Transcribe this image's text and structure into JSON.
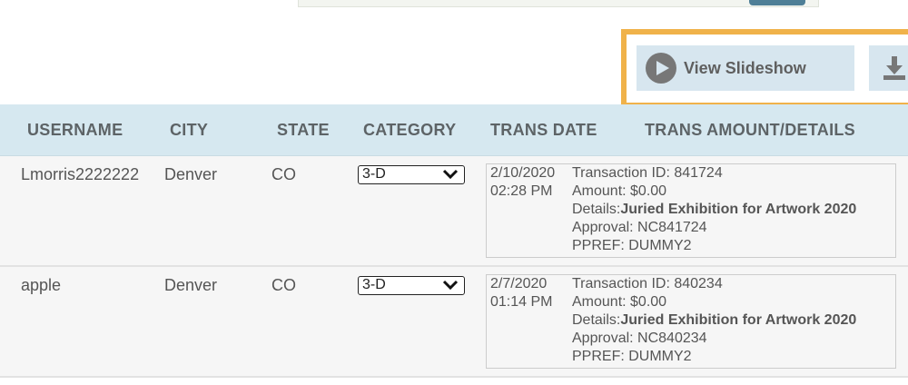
{
  "actions": {
    "slideshow_label": "View Slideshow"
  },
  "table": {
    "headers": [
      "USERNAME",
      "CITY",
      "STATE",
      "CATEGORY",
      "TRANS DATE",
      "TRANS AMOUNT/DETAILS"
    ],
    "rows": [
      {
        "username": "Lmorris2222222",
        "city": "Denver",
        "state": "CO",
        "category": "3-D",
        "date": "2/10/2020",
        "time": "02:28 PM",
        "transaction_id": "Transaction ID: 841724",
        "amount": "Amount: $0.00",
        "details_label": "Details:",
        "details_value": "Juried Exhibition for Artwork 2020",
        "approval": "Approval: NC841724",
        "ppref": "PPREF: DUMMY2"
      },
      {
        "username": "apple",
        "city": "Denver",
        "state": "CO",
        "category": "3-D",
        "date": "2/7/2020",
        "time": "01:14 PM",
        "transaction_id": "Transaction ID: 840234",
        "amount": "Amount: $0.00",
        "details_label": "Details:",
        "details_value": "Juried Exhibition for Artwork 2020",
        "approval": "Approval: NC840234",
        "ppref": "PPREF: DUMMY2"
      }
    ]
  },
  "colors": {
    "header_bg": "#d6e8f0",
    "highlight": "#f0b24a",
    "button_bg": "#d7e6ef"
  },
  "icons": {
    "slideshow": "play-circle-icon",
    "download": "download-icon",
    "select": "chevron-down-icon"
  }
}
